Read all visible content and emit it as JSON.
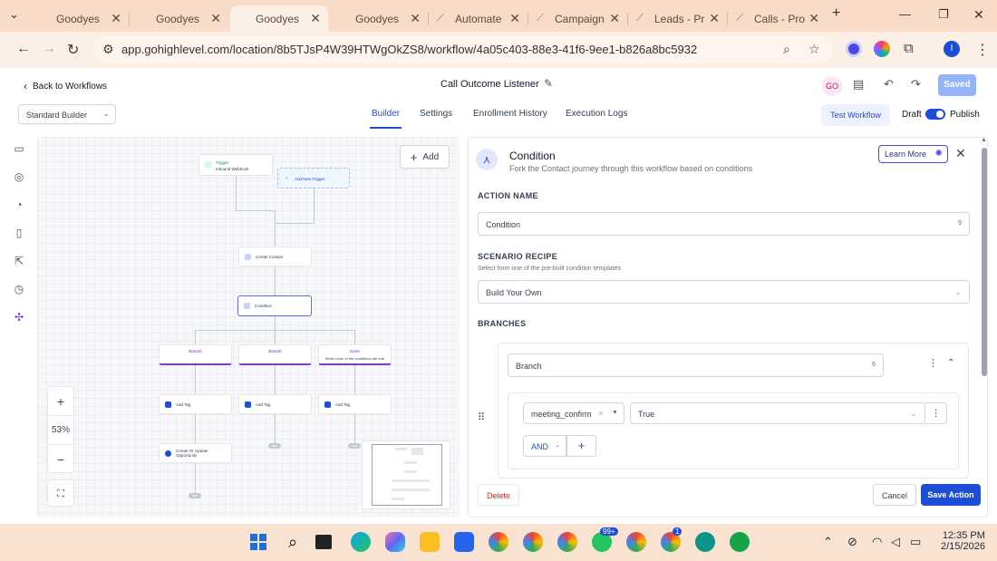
{
  "browser": {
    "tabs": [
      {
        "label": "Goodyes",
        "active": false
      },
      {
        "label": "Goodyes",
        "active": false
      },
      {
        "label": "Goodyes",
        "active": true
      },
      {
        "label": "Goodyes",
        "active": false
      },
      {
        "label": "Automate",
        "active": false
      },
      {
        "label": "Campaign",
        "active": false
      },
      {
        "label": "Leads - Pr",
        "active": false
      },
      {
        "label": "Calls - Pro",
        "active": false
      }
    ],
    "url": "app.gohighlevel.com/location/8b5TJsP4W39HTWgOkZS8/workflow/4a05c403-88e3-41f6-9ee1-b826a8bc5932",
    "profile_initial": "I"
  },
  "header": {
    "back_label": "Back to Workflows",
    "workflow_name": "Call Outcome Listener",
    "avatar_initials": "GO",
    "saved_label": "Saved"
  },
  "subheader": {
    "builder_select": "Standard Builder",
    "tabs": [
      "Builder",
      "Settings",
      "Enrollment History",
      "Execution Logs"
    ],
    "active_tab": "Builder",
    "test_workflow_label": "Test Workflow",
    "draft_label": "Draft",
    "publish_label": "Publish",
    "published": true
  },
  "canvas": {
    "add_label": "Add",
    "zoom": "53%",
    "trigger_title": "Trigger",
    "trigger_sub": "Inbound Webhook",
    "add_trigger_label": "Add New Trigger",
    "create_contact_label": "Create Contact",
    "condition_label": "Condition",
    "branch1_label": "Branch",
    "branch2_label": "Branch",
    "none_label": "None",
    "none_sub": "When none of the conditions are true",
    "addtag1": "Add Tag",
    "addtag2": "Add Tag",
    "addtag3": "Add Tag",
    "create_opp_label": "Create Or Update Opportunity",
    "end_label": "END"
  },
  "panel": {
    "title": "Condition",
    "subtitle": "Fork the Contact journey through this workflow based on conditions",
    "learn_more_label": "Learn More",
    "action_name_heading": "ACTION NAME",
    "action_name_value": "Condition",
    "action_name_count": "9",
    "scenario_heading": "SCENARIO RECIPE",
    "scenario_sub": "Select from one of the pre-built condition templates",
    "scenario_value": "Build Your Own",
    "branches_heading": "BRANCHES",
    "branch_name_value": "Branch",
    "branch_name_count": "6",
    "condition_field": "meeting_confirm",
    "condition_value": "True",
    "and_label": "AND",
    "delete_label": "Delete",
    "cancel_label": "Cancel",
    "save_label": "Save Action"
  },
  "taskbar": {
    "time": "12:35 PM",
    "date": "2/15/2026",
    "whatsapp_badge": "99+",
    "chrome_badge": "1"
  }
}
